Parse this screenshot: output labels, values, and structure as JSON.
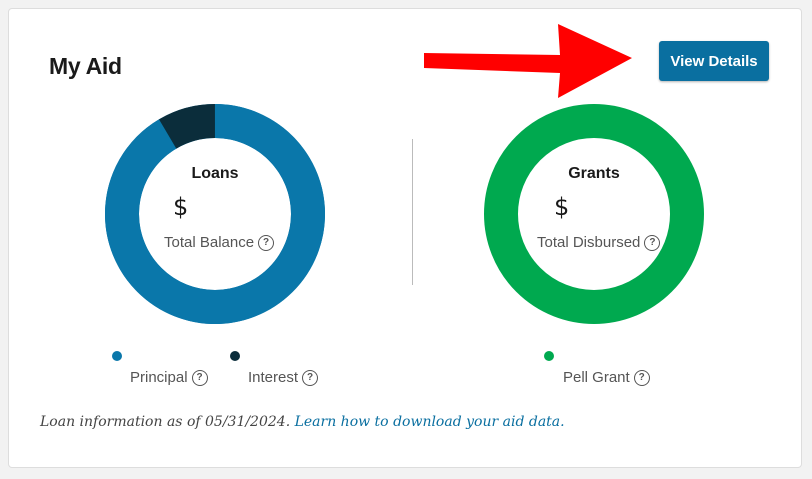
{
  "card": {
    "title": "My Aid",
    "view_details_label": "View Details"
  },
  "loans": {
    "title": "Loans",
    "amount": "$",
    "subtitle": "Total Balance",
    "principal_fraction": 0.915,
    "interest_fraction": 0.085,
    "colors": {
      "principal": "#0a77aa",
      "interest": "#0b2d3b"
    },
    "legend": [
      {
        "label": "Principal"
      },
      {
        "label": "Interest"
      }
    ]
  },
  "grants": {
    "title": "Grants",
    "amount": "$",
    "subtitle": "Total Disbursed",
    "color": "#00a94f",
    "legend": [
      {
        "label": "Pell Grant"
      }
    ]
  },
  "footer": {
    "text": "Loan information as of 05/31/2024.",
    "link": "Learn how to download your aid data."
  },
  "icons": {
    "help": "?"
  }
}
